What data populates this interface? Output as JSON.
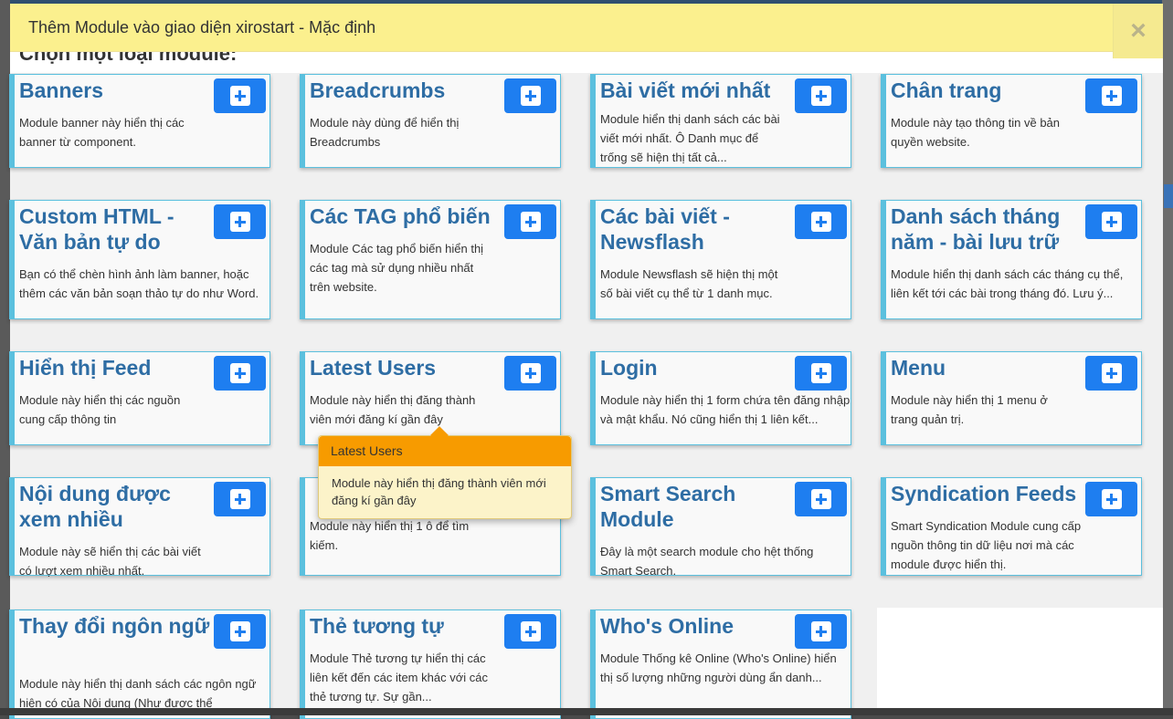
{
  "modal": {
    "title": "Thêm Module vào giao diện xirostart - Mặc định",
    "close_label": "×",
    "section_heading": "Chọn một loại module:"
  },
  "modules": [
    {
      "title": "Banners",
      "desc": "Module banner này hiển thị các banner từ component."
    },
    {
      "title": "Breadcrumbs",
      "desc": "Module này dùng để hiển thị Breadcrumbs"
    },
    {
      "title": "Bài viết mới nhất",
      "desc": "Module hiển thị danh sách các bài viết mới nhất. Ô Danh mục để trống sẽ hiện thị tất cả..."
    },
    {
      "title": "Chân trang",
      "desc": "Module này tạo thông tin về bản quyền website."
    },
    {
      "title": "Custom HTML - Văn bản tự do",
      "desc": "Bạn có thể chèn hình ảnh làm banner, hoặc thêm các văn bản soạn thảo tự do như Word."
    },
    {
      "title": "Các TAG phổ biến",
      "desc": "Module Các tag phổ biến hiển thị các tag mà sử dụng nhiều nhất trên website."
    },
    {
      "title": "Các bài viết - Newsflash",
      "desc": "Module Newsflash sẽ hiện thị một số bài viết cụ thể từ 1 danh mục."
    },
    {
      "title": "Danh sách tháng năm - bài lưu trữ",
      "desc": "Module hiển thị danh sách các tháng cụ thể, liên kết tới các bài trong tháng đó. Lưu ý..."
    },
    {
      "title": "Hiển thị Feed",
      "desc": "Module này hiển thị các nguồn cung cấp thông tin"
    },
    {
      "title": "Latest Users",
      "desc": "Module này hiển thị đăng thành viên mới đăng kí gần đây"
    },
    {
      "title": "Login",
      "desc": "Module này hiển thị 1 form chứa tên đăng nhập và mật khẩu. Nó cũng hiển thị 1 liên kết..."
    },
    {
      "title": "Menu",
      "desc": "Module này hiển thị 1 menu ở trang quản trị."
    },
    {
      "title": "Nội dung được xem nhiều",
      "desc": "Module này sẽ hiển thị các bài viết có lượt xem nhiều nhất."
    },
    {
      "title": "",
      "desc": "Module này hiển thị 1 ô để tìm kiếm."
    },
    {
      "title": "Smart Search Module",
      "desc": "Đây là một search module cho hệt thống Smart Search."
    },
    {
      "title": "Syndication Feeds",
      "desc": "Smart Syndication Module cung cấp nguồn thông tin dữ liệu nơi mà các module được hiển thị."
    },
    {
      "title": "Thay đổi ngôn ngữ",
      "desc": "Module này hiển thị danh sách các ngôn ngữ hiện có của Nội dung (Như được thể"
    },
    {
      "title": "Thẻ tương tự",
      "desc": "Module Thẻ tương tự hiển thị các liên kết đến các item khác với các thẻ tương tự. Sự gần..."
    },
    {
      "title": "Who's Online",
      "desc": "Module Thống kê Online (Who's Online) hiển thị số lượng những người dùng ẩn danh..."
    }
  ],
  "popover": {
    "title": "Latest Users",
    "body": "Module này hiển thị đăng thành viên mới đăng kí gần đây"
  },
  "icons": {
    "add": "plus-square-icon",
    "close": "close-icon"
  },
  "colors": {
    "header_bg": "#fbf08e",
    "card_accent": "#5bc0de",
    "title_blue": "#2e6da4",
    "button_blue": "#1e7ef0",
    "popover_header": "#f79b00",
    "popover_bg": "#fcf3c9"
  }
}
